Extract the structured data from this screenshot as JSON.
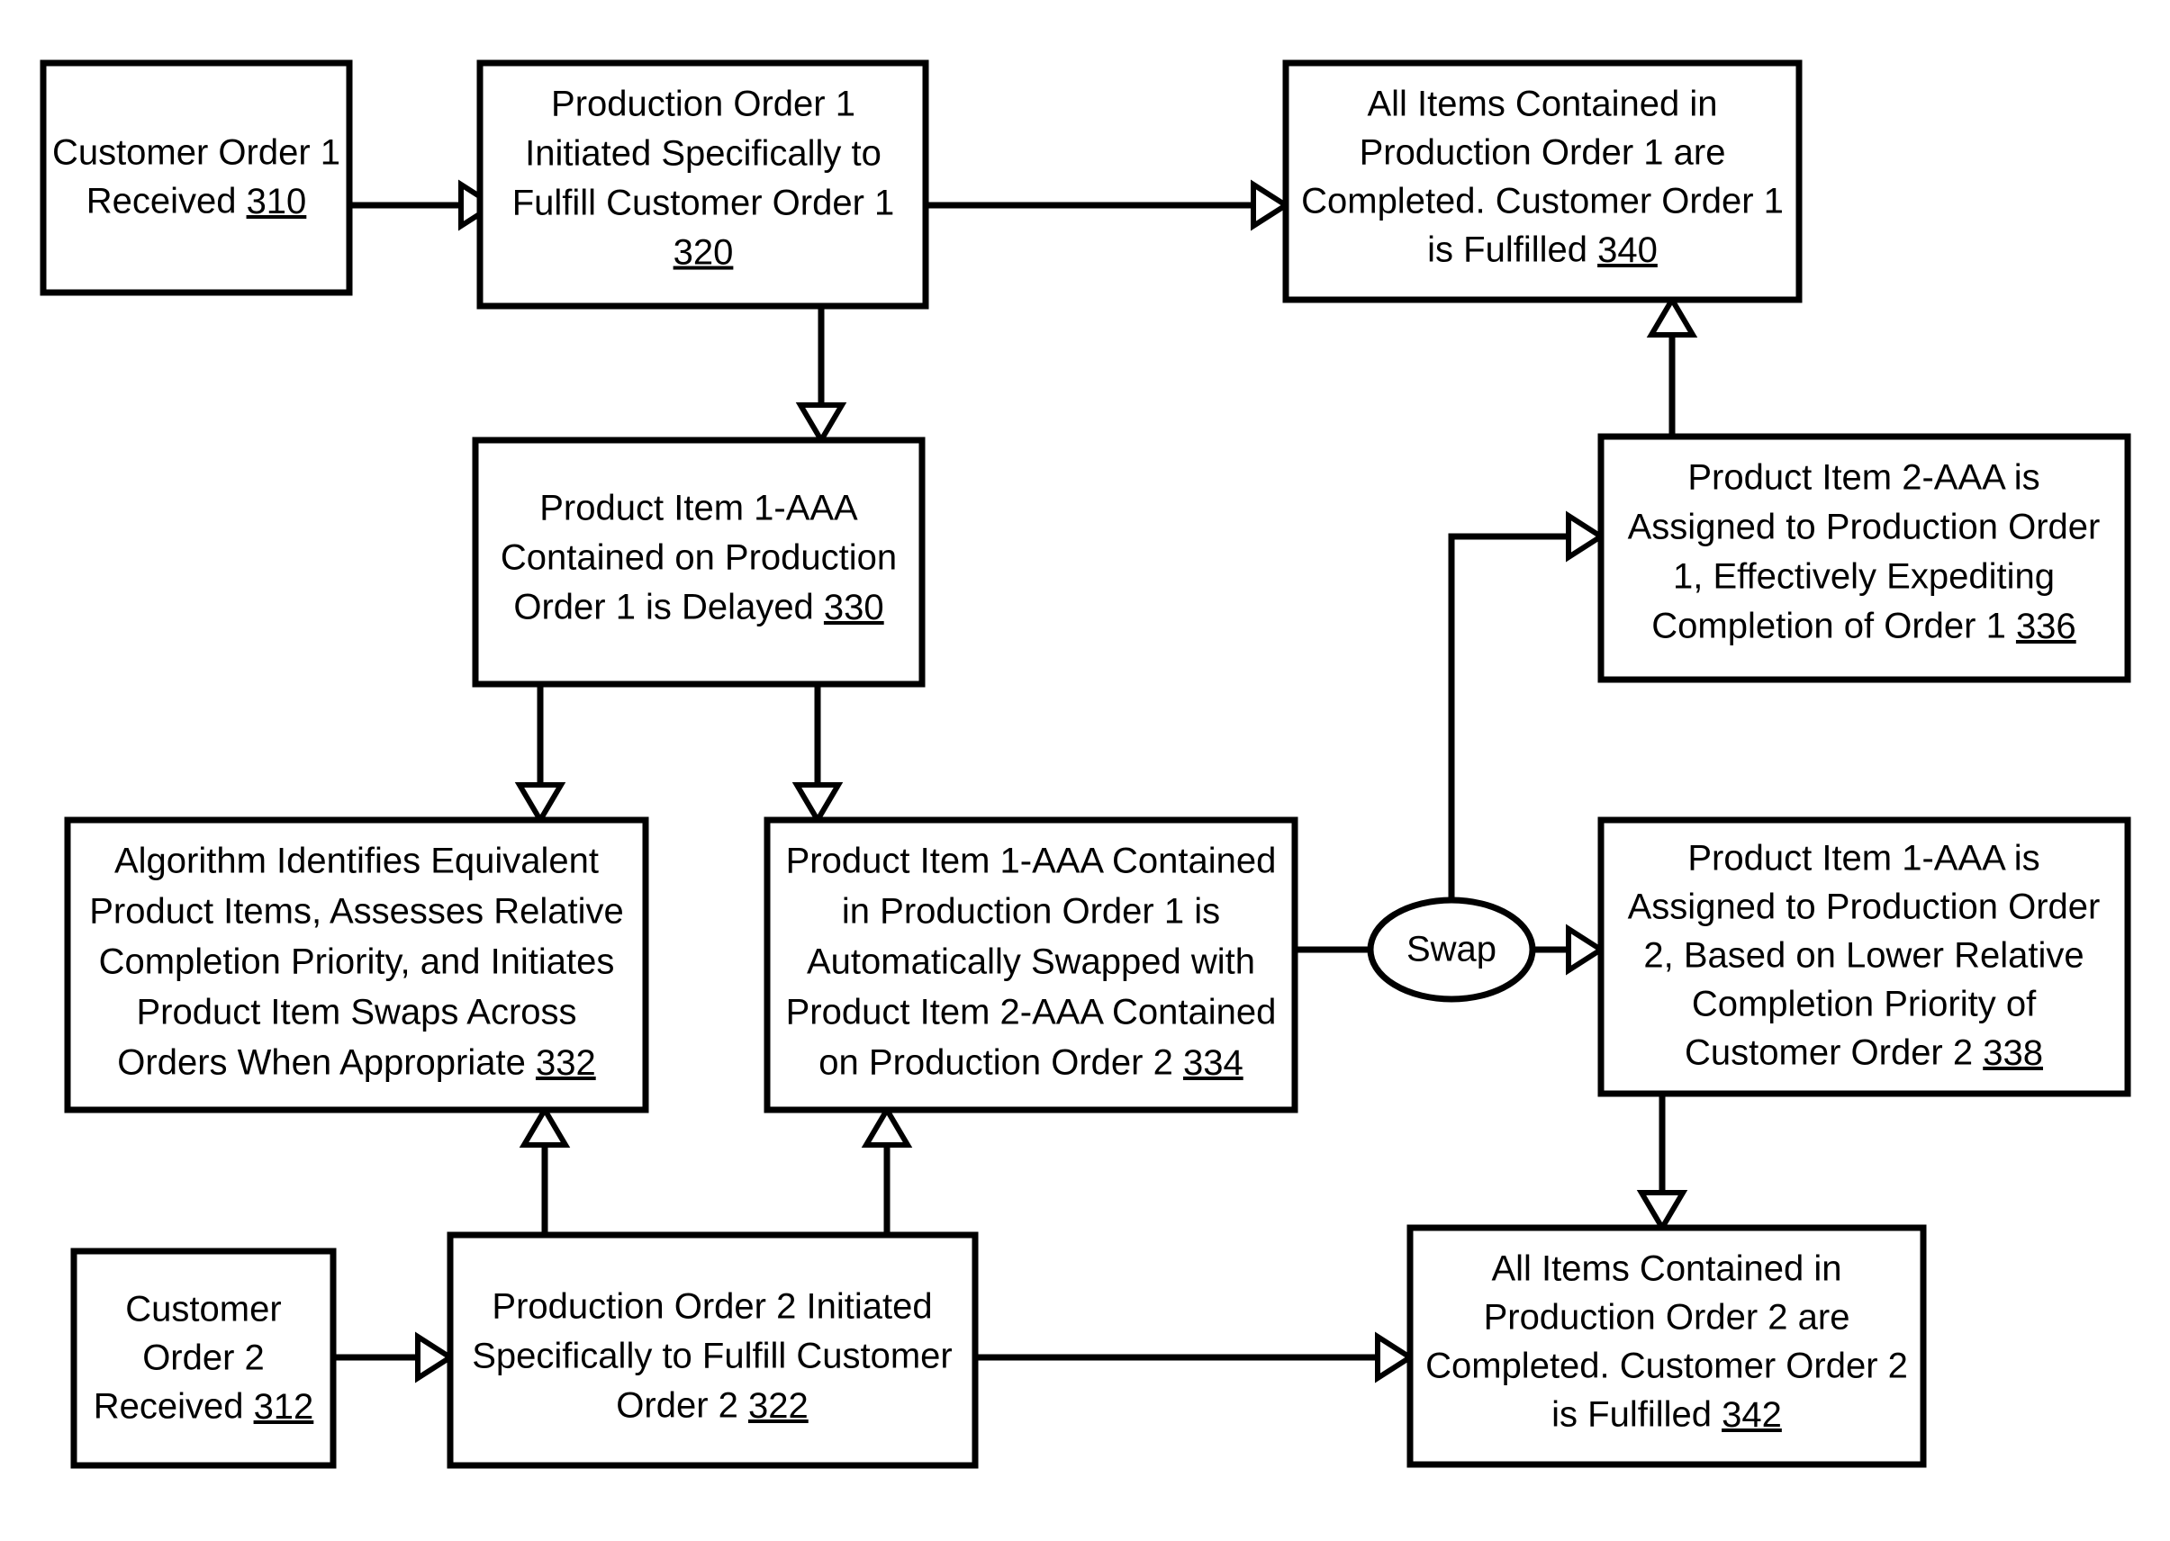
{
  "figure": {
    "title": "Production Order Item Swap Flowchart",
    "background_color": "#ffffff",
    "line_color": "#000000",
    "text_color": "#000000"
  },
  "nodes": {
    "n310": {
      "id": "310",
      "shape": "rectangle",
      "lines": [
        "Customer Order 1",
        "Received 310"
      ],
      "ref": "310",
      "text": "Customer Order 1 Received 310"
    },
    "n320": {
      "id": "320",
      "shape": "rectangle",
      "lines": [
        "Production Order 1",
        "Initiated Specifically to",
        "Fulfill Customer Order 1",
        "320"
      ],
      "ref": "320",
      "text": "Production Order 1 Initiated Specifically to Fulfill Customer Order 1 320"
    },
    "n340": {
      "id": "340",
      "shape": "rectangle",
      "lines": [
        "All Items Contained in",
        "Production Order 1 are",
        "Completed. Customer Order 1",
        "is Fulfilled 340"
      ],
      "ref": "340",
      "text": "All Items Contained in Production Order 1 are Completed. Customer Order 1 is Fulfilled 340"
    },
    "n330": {
      "id": "330",
      "shape": "rectangle",
      "lines": [
        "Product Item 1-AAA",
        "Contained on Production",
        "Order 1 is Delayed 330"
      ],
      "ref": "330",
      "text": "Product Item 1-AAA Contained on Production Order 1 is Delayed 330"
    },
    "n336": {
      "id": "336",
      "shape": "rectangle",
      "lines": [
        "Product Item 2-AAA is",
        "Assigned to Production Order",
        "1, Effectively Expediting",
        "Completion of Order 1 336"
      ],
      "ref": "336",
      "text": "Product Item 2-AAA is Assigned to Production Order 1, Effectively Expediting Completion of Order 1 336"
    },
    "n332": {
      "id": "332",
      "shape": "rectangle",
      "lines": [
        "Algorithm Identifies Equivalent",
        "Product Items, Assesses Relative",
        "Completion Priority, and Initiates",
        "Product Item Swaps Across",
        "Orders When Appropriate 332"
      ],
      "ref": "332",
      "text": "Algorithm Identifies Equivalent Product Items, Assesses Relative Completion Priority, and Initiates Product Item Swaps Across Orders When Appropriate 332"
    },
    "n334": {
      "id": "334",
      "shape": "rectangle",
      "lines": [
        "Product Item 1-AAA Contained",
        "in Production Order 1 is",
        "Automatically Swapped with",
        "Product Item 2-AAA Contained",
        "on Production Order 2 334"
      ],
      "ref": "334",
      "text": "Product Item 1-AAA Contained in Production Order 1 is Automatically Swapped with Product Item 2-AAA Contained on Production Order 2 334"
    },
    "nswap": {
      "id": "swap",
      "shape": "ellipse",
      "lines": [
        "Swap"
      ],
      "ref": "",
      "text": "Swap"
    },
    "n338": {
      "id": "338",
      "shape": "rectangle",
      "lines": [
        "Product Item 1-AAA is",
        "Assigned to Production Order",
        "2, Based on Lower Relative",
        "Completion Priority of",
        "Customer Order 2 338"
      ],
      "ref": "338",
      "text": "Product Item 1-AAA is Assigned to Production Order 2, Based on Lower Relative Completion Priority of Customer Order 2 338"
    },
    "n312": {
      "id": "312",
      "shape": "rectangle",
      "lines": [
        "Customer",
        "Order 2",
        "Received 312"
      ],
      "ref": "312",
      "text": "Customer Order 2 Received 312"
    },
    "n322": {
      "id": "322",
      "shape": "rectangle",
      "lines": [
        "Production Order 2 Initiated",
        "Specifically to Fulfill Customer",
        "Order 2 322"
      ],
      "ref": "322",
      "text": "Production Order 2 Initiated Specifically to Fulfill Customer Order 2 322"
    },
    "n342": {
      "id": "342",
      "shape": "rectangle",
      "lines": [
        "All Items Contained in",
        "Production Order 2 are",
        "Completed. Customer Order 2",
        "is Fulfilled 342"
      ],
      "ref": "342",
      "text": "All Items Contained in Production Order 2 are Completed. Customer Order 2 is Fulfilled 342"
    }
  },
  "edges": [
    {
      "from": "310",
      "to": "320",
      "direction": "right"
    },
    {
      "from": "320",
      "to": "340",
      "direction": "right"
    },
    {
      "from": "320",
      "to": "330",
      "direction": "down"
    },
    {
      "from": "330",
      "to": "332",
      "direction": "down"
    },
    {
      "from": "330",
      "to": "334",
      "direction": "down"
    },
    {
      "from": "334",
      "to": "swap",
      "direction": "right"
    },
    {
      "from": "swap",
      "to": "336",
      "direction": "up-right"
    },
    {
      "from": "swap",
      "to": "338",
      "direction": "right"
    },
    {
      "from": "336",
      "to": "340",
      "direction": "up"
    },
    {
      "from": "338",
      "to": "342",
      "direction": "down"
    },
    {
      "from": "312",
      "to": "322",
      "direction": "right"
    },
    {
      "from": "322",
      "to": "332",
      "direction": "up"
    },
    {
      "from": "322",
      "to": "334",
      "direction": "up"
    },
    {
      "from": "322",
      "to": "342",
      "direction": "right"
    }
  ]
}
